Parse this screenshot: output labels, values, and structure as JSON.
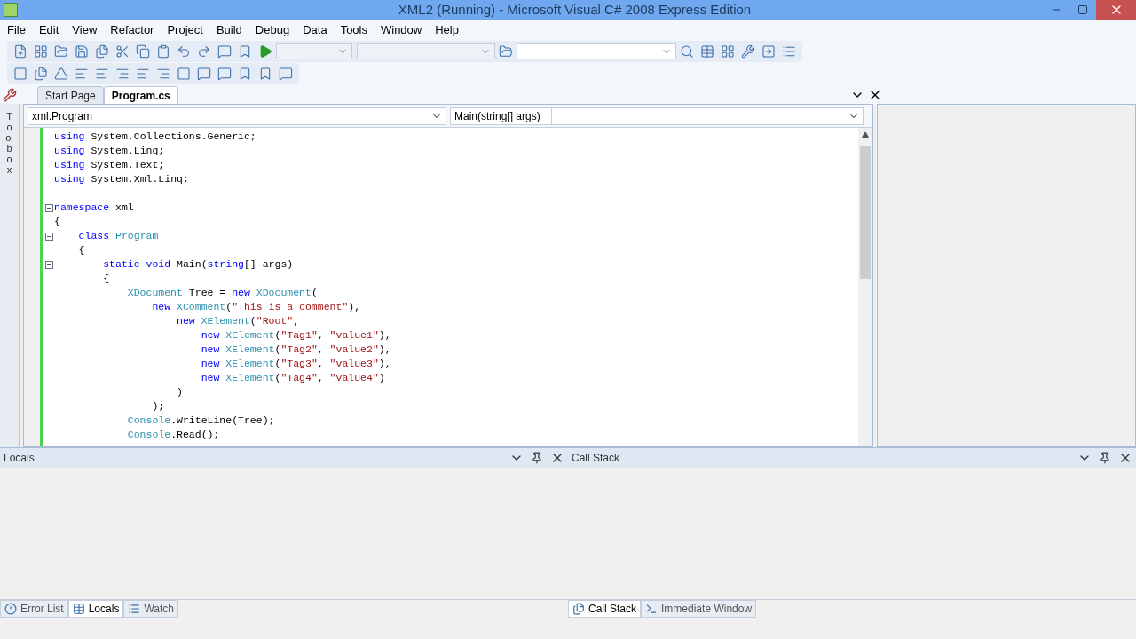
{
  "window": {
    "title": "XML2 (Running) - Microsoft Visual C# 2008 Express Edition"
  },
  "menu": [
    "File",
    "Edit",
    "View",
    "Refactor",
    "Project",
    "Build",
    "Debug",
    "Data",
    "Tools",
    "Window",
    "Help"
  ],
  "doc_tabs": [
    {
      "label": "Start Page",
      "selected": false
    },
    {
      "label": "Program.cs",
      "selected": true
    }
  ],
  "toolbox_label": "Toolbox",
  "nav": {
    "type_combo": "xml.Program",
    "member_combo": "Main(string[] args)"
  },
  "code": [
    {
      "fold": false,
      "tokens": [
        {
          "kind": "keyword",
          "text": "using"
        },
        {
          "kind": "plain",
          "text": " System.Collections.Generic;"
        }
      ]
    },
    {
      "fold": false,
      "tokens": [
        {
          "kind": "keyword",
          "text": "using"
        },
        {
          "kind": "plain",
          "text": " System.Linq;"
        }
      ]
    },
    {
      "fold": false,
      "tokens": [
        {
          "kind": "keyword",
          "text": "using"
        },
        {
          "kind": "plain",
          "text": " System.Text;"
        }
      ]
    },
    {
      "fold": false,
      "tokens": [
        {
          "kind": "keyword",
          "text": "using"
        },
        {
          "kind": "plain",
          "text": " System.Xml.Linq;"
        }
      ]
    },
    {
      "fold": false
    },
    {
      "fold": true,
      "tokens": [
        {
          "kind": "keyword",
          "text": "namespace"
        },
        {
          "kind": "plain",
          "text": " xml"
        }
      ]
    },
    {
      "fold": false,
      "tokens": [
        {
          "kind": "plain",
          "text": "{"
        }
      ]
    },
    {
      "fold": true,
      "tokens": [
        {
          "kind": "keyword",
          "text": "    class"
        },
        {
          "kind": "type",
          "text": " Program"
        }
      ]
    },
    {
      "fold": false,
      "tokens": [
        {
          "kind": "plain",
          "text": "    {"
        }
      ]
    },
    {
      "fold": true,
      "tokens": [
        {
          "kind": "keyword",
          "text": "        static void"
        },
        {
          "kind": "plain",
          "text": " Main("
        },
        {
          "kind": "keyword",
          "text": "string"
        },
        {
          "kind": "plain",
          "text": "[] args)"
        }
      ]
    },
    {
      "fold": false,
      "tokens": [
        {
          "kind": "plain",
          "text": "        {"
        }
      ]
    },
    {
      "fold": false,
      "tokens": [
        {
          "kind": "type",
          "text": "            XDocument"
        },
        {
          "kind": "plain",
          "text": " Tree = "
        },
        {
          "kind": "keyword",
          "text": "new"
        },
        {
          "kind": "type",
          "text": " XDocument"
        },
        {
          "kind": "plain",
          "text": "("
        }
      ]
    },
    {
      "fold": false,
      "tokens": [
        {
          "kind": "keyword",
          "text": "                new"
        },
        {
          "kind": "type",
          "text": " XComment"
        },
        {
          "kind": "plain",
          "text": "("
        },
        {
          "kind": "string",
          "text": "\"This is a comment\""
        },
        {
          "kind": "plain",
          "text": "),"
        }
      ]
    },
    {
      "fold": false,
      "tokens": [
        {
          "kind": "keyword",
          "text": "                    new"
        },
        {
          "kind": "type",
          "text": " XElement"
        },
        {
          "kind": "plain",
          "text": "("
        },
        {
          "kind": "string",
          "text": "\"Root\""
        },
        {
          "kind": "plain",
          "text": ","
        }
      ]
    },
    {
      "fold": false,
      "tokens": [
        {
          "kind": "keyword",
          "text": "                        new"
        },
        {
          "kind": "type",
          "text": " XElement"
        },
        {
          "kind": "plain",
          "text": "("
        },
        {
          "kind": "string",
          "text": "\"Tag1\""
        },
        {
          "kind": "plain",
          "text": ", "
        },
        {
          "kind": "string",
          "text": "\"value1\""
        },
        {
          "kind": "plain",
          "text": "),"
        }
      ]
    },
    {
      "fold": false,
      "tokens": [
        {
          "kind": "keyword",
          "text": "                        new"
        },
        {
          "kind": "type",
          "text": " XElement"
        },
        {
          "kind": "plain",
          "text": "("
        },
        {
          "kind": "string",
          "text": "\"Tag2\""
        },
        {
          "kind": "plain",
          "text": ", "
        },
        {
          "kind": "string",
          "text": "\"value2\""
        },
        {
          "kind": "plain",
          "text": "),"
        }
      ]
    },
    {
      "fold": false,
      "tokens": [
        {
          "kind": "keyword",
          "text": "                        new"
        },
        {
          "kind": "type",
          "text": " XElement"
        },
        {
          "kind": "plain",
          "text": "("
        },
        {
          "kind": "string",
          "text": "\"Tag3\""
        },
        {
          "kind": "plain",
          "text": ", "
        },
        {
          "kind": "string",
          "text": "\"value3\""
        },
        {
          "kind": "plain",
          "text": "),"
        }
      ]
    },
    {
      "fold": false,
      "tokens": [
        {
          "kind": "keyword",
          "text": "                        new"
        },
        {
          "kind": "type",
          "text": " XElement"
        },
        {
          "kind": "plain",
          "text": "("
        },
        {
          "kind": "string",
          "text": "\"Tag4\""
        },
        {
          "kind": "plain",
          "text": ", "
        },
        {
          "kind": "string",
          "text": "\"value4\""
        },
        {
          "kind": "plain",
          "text": ")"
        }
      ]
    },
    {
      "fold": false,
      "tokens": [
        {
          "kind": "plain",
          "text": "                    )"
        }
      ]
    },
    {
      "fold": false,
      "tokens": [
        {
          "kind": "plain",
          "text": "                );"
        }
      ]
    },
    {
      "fold": false,
      "tokens": [
        {
          "kind": "type",
          "text": "            Console"
        },
        {
          "kind": "plain",
          "text": ".WriteLine(Tree);"
        }
      ]
    },
    {
      "fold": false,
      "tokens": [
        {
          "kind": "type",
          "text": "            Console"
        },
        {
          "kind": "plain",
          "text": ".Read();"
        }
      ]
    }
  ],
  "panels": [
    {
      "title": "Locals",
      "tabs": [
        {
          "label": "Error List",
          "selected": false
        },
        {
          "label": "Locals",
          "selected": true
        },
        {
          "label": "Watch",
          "selected": false
        }
      ]
    },
    {
      "title": "Call Stack",
      "tabs": [
        {
          "label": "Call Stack",
          "selected": true
        },
        {
          "label": "Immediate Window",
          "selected": false
        }
      ]
    }
  ]
}
